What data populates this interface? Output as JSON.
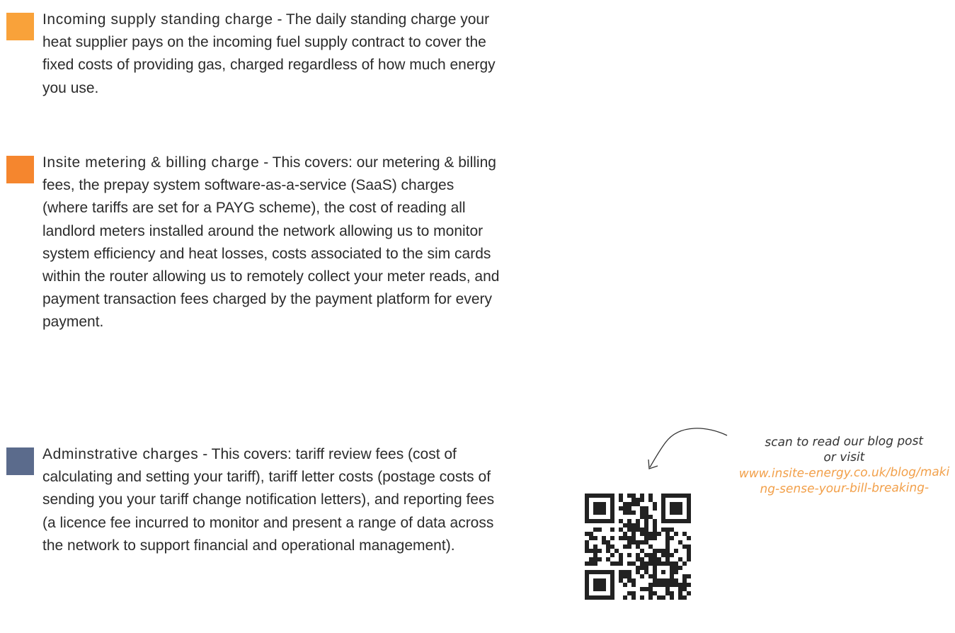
{
  "charges": [
    {
      "color": "#f9a23a",
      "title": "Incoming supply standing charge",
      "separator": " - ",
      "description": "The daily standing charge your heat supplier pays on the incoming fuel supply contract to cover the fixed costs of providing gas, charged regardless of how much energy you use."
    },
    {
      "color": "#f5862e",
      "title": "Insite metering & billing charge",
      "separator": " - ",
      "description": "This covers: our metering & billing fees, the prepay system software-as-a-service (SaaS) charges (where tariffs are set for a PAYG scheme), the cost of reading all landlord meters installed around the network allowing us to monitor system efficiency and heat losses, costs associated to the sim cards within the router allowing us to remotely collect your meter reads, and payment transaction fees charged by the payment platform for every payment."
    },
    {
      "color": "#5b6b8c",
      "title": "Adminstrative charges",
      "separator": " - ",
      "description": "This covers: tariff review fees (cost of calculating and setting your tariff), tariff letter costs (postage costs of sending you your tariff change notification letters), and reporting fees (a licence fee incurred to monitor and present a range of data across the network to support financial and operational management)."
    }
  ],
  "scan": {
    "line1": "scan to read our blog post",
    "line2": "or visit",
    "link": "www.insite-energy.co.uk/blog/making-sense-your-bill-breaking-",
    "link_color": "#f2a04a",
    "qr_icon": "qr-code-icon",
    "arrow_icon": "curved-arrow-icon"
  }
}
